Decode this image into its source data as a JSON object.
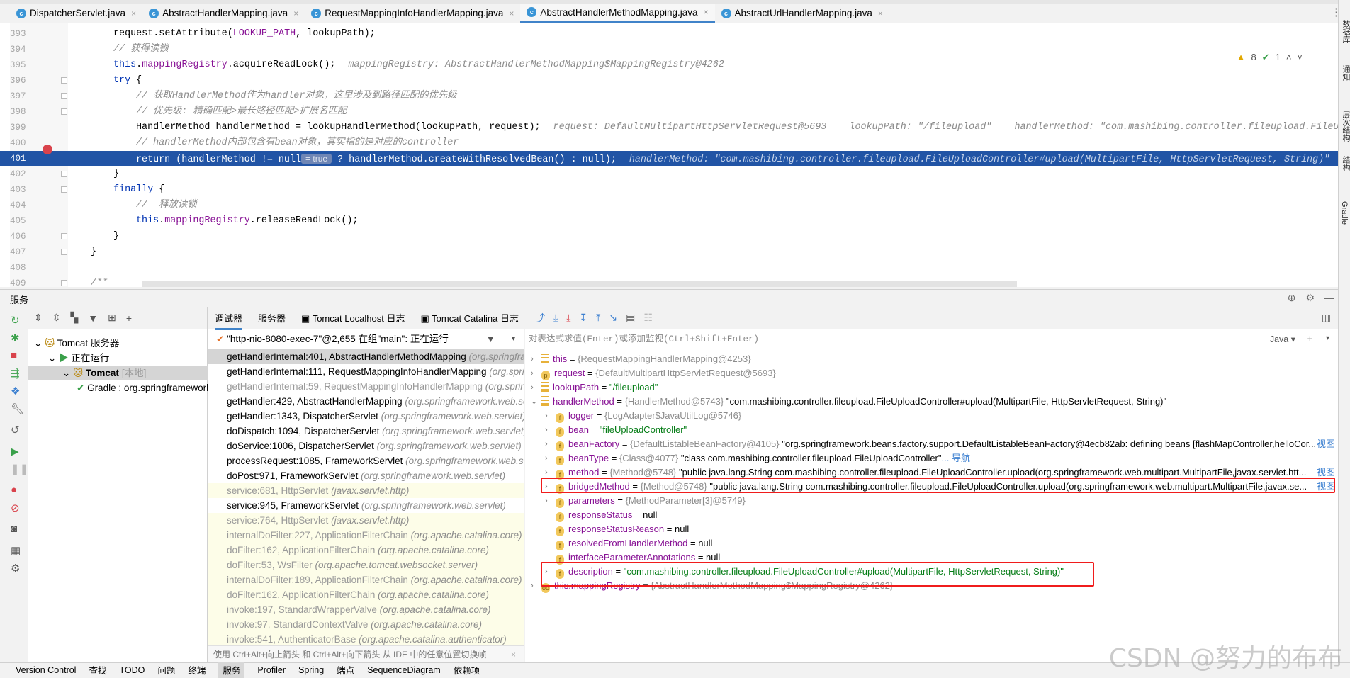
{
  "editor_tabs": [
    {
      "label": "DispatcherServlet.java",
      "active": false
    },
    {
      "label": "AbstractHandlerMapping.java",
      "active": false
    },
    {
      "label": "RequestMappingInfoHandlerMapping.java",
      "active": false
    },
    {
      "label": "AbstractHandlerMethodMapping.java",
      "active": true
    },
    {
      "label": "AbstractUrlHandlerMapping.java",
      "active": false
    }
  ],
  "inspections": {
    "warnings": "8",
    "ok": "1"
  },
  "code_lines": [
    {
      "n": "393",
      "indent": 3,
      "tokens": [
        [
          "request.setAttribute(",
          "p"
        ],
        [
          "LOOKUP_PATH",
          "field"
        ],
        [
          ", lookupPath);",
          "p"
        ]
      ]
    },
    {
      "n": "394",
      "indent": 3,
      "tokens": [
        [
          "// 获得读锁",
          "comment"
        ]
      ]
    },
    {
      "n": "395",
      "indent": 3,
      "tokens": [
        [
          "this",
          "kw"
        ],
        [
          ".",
          "p"
        ],
        [
          "mappingRegistry",
          "field"
        ],
        [
          ".acquireReadLock();",
          "p"
        ]
      ],
      "hint": "mappingRegistry: AbstractHandlerMethodMapping$MappingRegistry@4262"
    },
    {
      "n": "396",
      "indent": 3,
      "fold": true,
      "tokens": [
        [
          "try",
          "kw"
        ],
        [
          " {",
          "p"
        ]
      ]
    },
    {
      "n": "397",
      "indent": 4,
      "fold": true,
      "tokens": [
        [
          "// 获取HandlerMethod作为handler对象，这里涉及到路径匹配的优先级",
          "comment"
        ]
      ]
    },
    {
      "n": "398",
      "indent": 4,
      "fold": true,
      "tokens": [
        [
          "// 优先级: 精确匹配>最长路径匹配>扩展名匹配",
          "comment"
        ]
      ]
    },
    {
      "n": "399",
      "indent": 4,
      "tokens": [
        [
          "HandlerMethod handlerMethod = lookupHandlerMethod(lookupPath, request);",
          "p"
        ]
      ],
      "hint": "request: DefaultMultipartHttpServletRequest@5693    lookupPath: \"/fileupload\"    handlerMethod: \"com.mashibing.controller.fileupload.FileUploadController#upload(MultipartFile, HttpServletRequest, String)\""
    },
    {
      "n": "400",
      "indent": 4,
      "tokens": [
        [
          "// handlerMethod内部包含有bean对象，其实指的是对应的controller",
          "comment"
        ]
      ]
    },
    {
      "n": "401",
      "indent": 4,
      "exec": true,
      "tokens": [
        [
          "return (handlerMethod != null",
          "p"
        ],
        [
          "= true",
          "inl"
        ],
        [
          " ? handlerMethod.createWithResolvedBean() : null);",
          "p"
        ]
      ],
      "hint": "handlerMethod: \"com.mashibing.controller.fileupload.FileUploadController#upload(MultipartFile, HttpServletRequest, String)\""
    },
    {
      "n": "402",
      "indent": 3,
      "fold": true,
      "tokens": [
        [
          "}",
          "p"
        ]
      ]
    },
    {
      "n": "403",
      "indent": 3,
      "fold": true,
      "tokens": [
        [
          "finally",
          "kw"
        ],
        [
          " {",
          "p"
        ]
      ]
    },
    {
      "n": "404",
      "indent": 4,
      "tokens": [
        [
          "//  释放读锁",
          "comment"
        ]
      ]
    },
    {
      "n": "405",
      "indent": 4,
      "tokens": [
        [
          "this",
          "kw"
        ],
        [
          ".",
          "p"
        ],
        [
          "mappingRegistry",
          "field"
        ],
        [
          ".releaseReadLock();",
          "p"
        ]
      ]
    },
    {
      "n": "406",
      "indent": 3,
      "fold": true,
      "tokens": [
        [
          "}",
          "p"
        ]
      ]
    },
    {
      "n": "407",
      "indent": 2,
      "fold": true,
      "tokens": [
        [
          "}",
          "p"
        ]
      ]
    },
    {
      "n": "408",
      "indent": 2,
      "tokens": []
    },
    {
      "n": "409",
      "indent": 2,
      "fold": true,
      "tokens": [
        [
          "/**",
          "comment"
        ]
      ]
    }
  ],
  "right_sidebar": [
    "数据库",
    "通知",
    "层次结构",
    "结构",
    "Gradle"
  ],
  "services": {
    "title": "服务"
  },
  "tree": [
    {
      "label": "Tomcat 服务器",
      "level": 0,
      "expanded": true
    },
    {
      "label": "正在运行",
      "level": 1,
      "expanded": true
    },
    {
      "label": "Tomcat",
      "suffix": "[本地]",
      "level": 2,
      "expanded": true,
      "selected": true
    },
    {
      "label": "Gradle : org.springframework",
      "level": 3
    }
  ],
  "debug_tabs": [
    "调试器",
    "服务器",
    "Tomcat Localhost 日志",
    "Tomcat Catalina 日志"
  ],
  "thread": "\"http-nio-8080-exec-7\"@2,655 在组\"main\": 正在运行",
  "frames": [
    {
      "m": "getHandlerInternal:401, AbstractHandlerMethodMapping",
      "p": "(org.springframework.web.servlet.handler)",
      "s": "sel"
    },
    {
      "m": "getHandlerInternal:111, RequestMappingInfoHandlerMapping",
      "p": "(org.springframework.web.servlet.mvc.method)",
      "s": ""
    },
    {
      "m": "getHandlerInternal:59, RequestMappingInfoHandlerMapping",
      "p": "(org.springframework.web.servlet.mvc.method)",
      "s": "dimw"
    },
    {
      "m": "getHandler:429, AbstractHandlerMapping",
      "p": "(org.springframework.web.servlet.handler)",
      "s": ""
    },
    {
      "m": "getHandler:1343, DispatcherServlet",
      "p": "(org.springframework.web.servlet)",
      "s": ""
    },
    {
      "m": "doDispatch:1094, DispatcherServlet",
      "p": "(org.springframework.web.servlet)",
      "s": ""
    },
    {
      "m": "doService:1006, DispatcherServlet",
      "p": "(org.springframework.web.servlet)",
      "s": ""
    },
    {
      "m": "processRequest:1085, FrameworkServlet",
      "p": "(org.springframework.web.servlet)",
      "s": ""
    },
    {
      "m": "doPost:971, FrameworkServlet",
      "p": "(org.springframework.web.servlet)",
      "s": ""
    },
    {
      "m": "service:681, HttpServlet",
      "p": "(javax.servlet.http)",
      "s": "dim"
    },
    {
      "m": "service:945, FrameworkServlet",
      "p": "(org.springframework.web.servlet)",
      "s": ""
    },
    {
      "m": "service:764, HttpServlet",
      "p": "(javax.servlet.http)",
      "s": "dim"
    },
    {
      "m": "internalDoFilter:227, ApplicationFilterChain",
      "p": "(org.apache.catalina.core)",
      "s": "dim"
    },
    {
      "m": "doFilter:162, ApplicationFilterChain",
      "p": "(org.apache.catalina.core)",
      "s": "dim"
    },
    {
      "m": "doFilter:53, WsFilter",
      "p": "(org.apache.tomcat.websocket.server)",
      "s": "dim"
    },
    {
      "m": "internalDoFilter:189, ApplicationFilterChain",
      "p": "(org.apache.catalina.core)",
      "s": "dim"
    },
    {
      "m": "doFilter:162, ApplicationFilterChain",
      "p": "(org.apache.catalina.core)",
      "s": "dim"
    },
    {
      "m": "invoke:197, StandardWrapperValve",
      "p": "(org.apache.catalina.core)",
      "s": "dim"
    },
    {
      "m": "invoke:97, StandardContextValve",
      "p": "(org.apache.catalina.core)",
      "s": "dim"
    },
    {
      "m": "invoke:541, AuthenticatorBase",
      "p": "(org.apache.catalina.authenticator)",
      "s": "dim"
    }
  ],
  "frames_hint": "使用 Ctrl+Alt+向上箭头 和 Ctrl+Alt+向下箭头 从 IDE 中的任意位置切换帧",
  "eval_placeholder": "对表达式求值(Enter)或添加监视(Ctrl+Shift+Enter)",
  "eval_lang": "Java",
  "variables": [
    {
      "lvl": 0,
      "exp": ">",
      "icon": "bars",
      "name": "this",
      "type": "{RequestMappingHandlerMapping@4253}",
      "val": ""
    },
    {
      "lvl": 0,
      "exp": ">",
      "icon": "p",
      "name": "request",
      "type": "{DefaultMultipartHttpServletRequest@5693}",
      "val": ""
    },
    {
      "lvl": 0,
      "exp": ">",
      "icon": "bars",
      "name": "lookupPath",
      "type": "",
      "val": "\"/fileupload\"",
      "str": true
    },
    {
      "lvl": 0,
      "exp": "v",
      "icon": "bars",
      "name": "handlerMethod",
      "type": "{HandlerMethod@5743}",
      "val": "\"com.mashibing.controller.fileupload.FileUploadController#upload(MultipartFile, HttpServletRequest, String)\""
    },
    {
      "lvl": 1,
      "exp": ">",
      "icon": "f",
      "name": "logger",
      "type": "{LogAdapter$JavaUtilLog@5746}",
      "val": ""
    },
    {
      "lvl": 1,
      "exp": ">",
      "icon": "f",
      "name": "bean",
      "type": "",
      "val": "\"fileUploadController\"",
      "str": true
    },
    {
      "lvl": 1,
      "exp": ">",
      "icon": "f",
      "name": "beanFactory",
      "type": "{DefaultListableBeanFactory@4105}",
      "val": "\"org.springframework.beans.factory.support.DefaultListableBeanFactory@4ecb82ab: defining beans [flashMapController,helloCor...",
      "link": "视图"
    },
    {
      "lvl": 1,
      "exp": ">",
      "icon": "f",
      "name": "beanType",
      "type": "{Class@4077}",
      "val": "\"class com.mashibing.controller.fileupload.FileUploadController\"",
      "go": "... 导航"
    },
    {
      "lvl": 1,
      "exp": ">",
      "icon": "f",
      "name": "method",
      "type": "{Method@5748}",
      "val": "\"public java.lang.String com.mashibing.controller.fileupload.FileUploadController.upload(org.springframework.web.multipart.MultipartFile,javax.servlet.htt...",
      "link": "视图"
    },
    {
      "lvl": 1,
      "exp": ">",
      "icon": "f",
      "name": "bridgedMethod",
      "type": "{Method@5748}",
      "val": "\"public java.lang.String com.mashibing.controller.fileupload.FileUploadController.upload(org.springframework.web.multipart.MultipartFile,javax.se...",
      "link": "视图"
    },
    {
      "lvl": 1,
      "exp": ">",
      "icon": "f",
      "name": "parameters",
      "type": "{MethodParameter[3]@5749}",
      "val": ""
    },
    {
      "lvl": 1,
      "exp": "",
      "icon": "f",
      "name": "responseStatus",
      "type": "",
      "val": "null"
    },
    {
      "lvl": 1,
      "exp": "",
      "icon": "f",
      "name": "responseStatusReason",
      "type": "",
      "val": "null"
    },
    {
      "lvl": 1,
      "exp": "",
      "icon": "f",
      "name": "resolvedFromHandlerMethod",
      "type": "",
      "val": "null"
    },
    {
      "lvl": 1,
      "exp": "",
      "icon": "f",
      "name": "interfaceParameterAnnotations",
      "type": "",
      "val": "null"
    },
    {
      "lvl": 1,
      "exp": ">",
      "icon": "f",
      "name": "description",
      "type": "",
      "val": "\"com.mashibing.controller.fileupload.FileUploadController#upload(MultipartFile, HttpServletRequest, String)\"",
      "str": true
    },
    {
      "lvl": 0,
      "exp": ">",
      "icon": "oo",
      "name": "this.mappingRegistry",
      "type": "{AbstractHandlerMethodMapping$MappingRegistry@4262}",
      "val": ""
    }
  ],
  "status_bar": [
    "Version Control",
    "查找",
    "TODO",
    "问题",
    "终端",
    "服务",
    "Profiler",
    "Spring",
    "端点",
    "SequenceDiagram",
    "依赖项"
  ],
  "status_active": "服务",
  "watermark": "CSDN @努力的布布",
  "colors": {
    "accent": "#4083c9",
    "exec_line": "#2154a5",
    "highlight_box": "#f01c1c"
  }
}
